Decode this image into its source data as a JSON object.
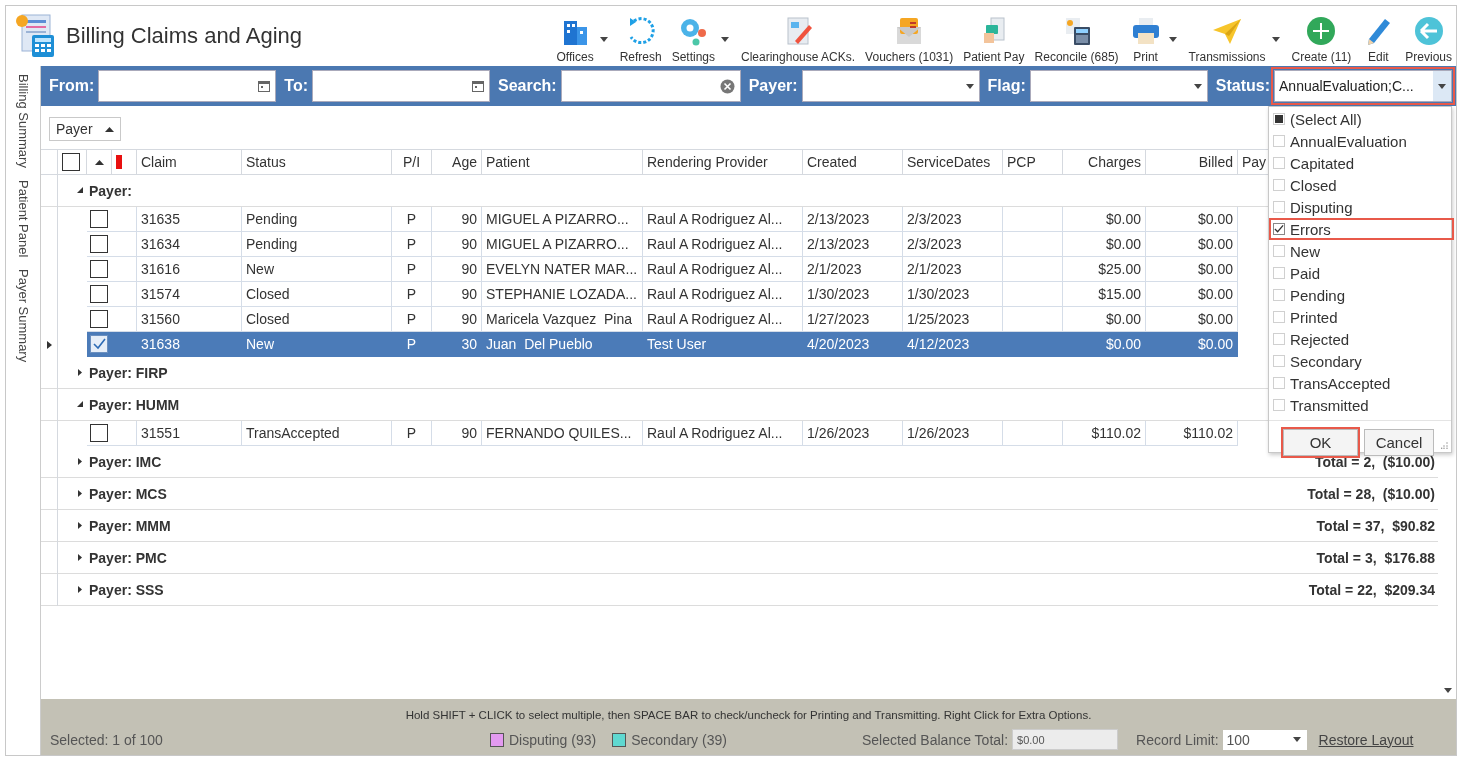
{
  "window": {
    "title": "Billing Claims and Aging"
  },
  "toolbar": [
    {
      "label": "Offices",
      "has_dropdown": true
    },
    {
      "label": "Refresh",
      "has_dropdown": false
    },
    {
      "label": "Settings",
      "has_dropdown": true
    },
    {
      "label": "Clearinghouse ACKs.",
      "has_dropdown": false
    },
    {
      "label": "Vouchers (1031)",
      "has_dropdown": false
    },
    {
      "label": "Patient Pay",
      "has_dropdown": false
    },
    {
      "label": "Reconcile (685)",
      "has_dropdown": false
    },
    {
      "label": "Print",
      "has_dropdown": true
    },
    {
      "label": "Transmissions",
      "has_dropdown": true
    },
    {
      "label": "Create (11)",
      "has_dropdown": false
    },
    {
      "label": "Edit",
      "has_dropdown": false
    },
    {
      "label": "Previous",
      "has_dropdown": false
    }
  ],
  "side_tabs": [
    "Billing Summary",
    "Patient Panel",
    "Payer Summary"
  ],
  "filters": [
    {
      "label": "From:",
      "kind": "date"
    },
    {
      "label": "To:",
      "kind": "date"
    },
    {
      "label": "Search:",
      "kind": "search"
    },
    {
      "label": "Payer:",
      "kind": "combo"
    },
    {
      "label": "Flag:",
      "kind": "combo"
    },
    {
      "label": "Status:",
      "kind": "combo",
      "value": "AnnualEvaluation;C...",
      "highlighted": true
    }
  ],
  "group_by": "Payer",
  "grid": {
    "header_checkbox": {
      "checked": false
    },
    "columns": [
      "Claim",
      "Status",
      "P/I",
      "Age",
      "Patient",
      "Rendering Provider",
      "Created",
      "ServiceDates",
      "PCP",
      "Charges",
      "Billed",
      "Pay"
    ],
    "groups": [
      {
        "label": "Payer:",
        "expanded": true,
        "rows": [
          {
            "checked": false,
            "selected": false,
            "cells": [
              "31635",
              "Pending",
              "P",
              "90",
              "MIGUEL A PIZARRO...",
              "Raul A Rodriguez Al...",
              "2/13/2023",
              "2/3/2023",
              null,
              "$0.00",
              "$0.00"
            ]
          },
          {
            "checked": false,
            "selected": false,
            "cells": [
              "31634",
              "Pending",
              "P",
              "90",
              "MIGUEL A PIZARRO...",
              "Raul A Rodriguez Al...",
              "2/13/2023",
              "2/3/2023",
              null,
              "$0.00",
              "$0.00"
            ]
          },
          {
            "checked": false,
            "selected": false,
            "cells": [
              "31616",
              "New",
              "P",
              "90",
              "EVELYN NATER MAR...",
              "Raul A Rodriguez Al...",
              "2/1/2023",
              "2/1/2023",
              null,
              "$25.00",
              "$0.00"
            ]
          },
          {
            "checked": false,
            "selected": false,
            "cells": [
              "31574",
              "Closed",
              "P",
              "90",
              "STEPHANIE LOZADA...",
              "Raul A Rodriguez Al...",
              "1/30/2023",
              "1/30/2023",
              null,
              "$15.00",
              "$0.00"
            ]
          },
          {
            "checked": false,
            "selected": false,
            "cells": [
              "31560",
              "Closed",
              "P",
              "90",
              "Maricela Vazquez  Pina",
              "Raul A Rodriguez Al...",
              "1/27/2023",
              "1/25/2023",
              null,
              "$0.00",
              "$0.00"
            ]
          },
          {
            "checked": true,
            "selected": true,
            "cells": [
              "31638",
              "New",
              "P",
              "30",
              "Juan  Del Pueblo",
              "Test User",
              "4/20/2023",
              "4/12/2023",
              null,
              "$0.00",
              "$0.00"
            ]
          }
        ]
      },
      {
        "label": "Payer: FIRP",
        "expanded": false
      },
      {
        "label": "Payer: HUMM",
        "expanded": true,
        "rows": [
          {
            "checked": false,
            "selected": false,
            "cells": [
              "31551",
              "TransAccepted",
              "P",
              "90",
              "FERNANDO QUILES...",
              "Raul A Rodriguez Al...",
              "1/26/2023",
              "1/26/2023",
              null,
              "$110.02",
              "$110.02"
            ]
          }
        ]
      },
      {
        "label": "Payer: IMC",
        "expanded": false,
        "total": "Total = 2,  ($10.00)"
      },
      {
        "label": "Payer: MCS",
        "expanded": false,
        "total": "Total = 28,  ($10.00)"
      },
      {
        "label": "Payer: MMM",
        "expanded": false,
        "total": "Total = 37,  $90.82"
      },
      {
        "label": "Payer: PMC",
        "expanded": false,
        "total": "Total = 3,  $176.88"
      },
      {
        "label": "Payer: SSS",
        "expanded": false,
        "total": "Total = 22,  $209.34"
      }
    ]
  },
  "status_dropdown": {
    "items": [
      {
        "label": "(Select All)",
        "checked": false,
        "partial": true,
        "highlighted": false
      },
      {
        "label": "AnnualEvaluation",
        "checked": false,
        "partial": false,
        "highlighted": false
      },
      {
        "label": "Capitated",
        "checked": false,
        "partial": false,
        "highlighted": false
      },
      {
        "label": "Closed",
        "checked": false,
        "partial": false,
        "highlighted": false
      },
      {
        "label": "Disputing",
        "checked": false,
        "partial": false,
        "highlighted": false
      },
      {
        "label": "Errors",
        "checked": true,
        "partial": false,
        "highlighted": true
      },
      {
        "label": "New",
        "checked": false,
        "partial": false,
        "highlighted": false
      },
      {
        "label": "Paid",
        "checked": false,
        "partial": false,
        "highlighted": false
      },
      {
        "label": "Pending",
        "checked": false,
        "partial": false,
        "highlighted": false
      },
      {
        "label": "Printed",
        "checked": false,
        "partial": false,
        "highlighted": false
      },
      {
        "label": "Rejected",
        "checked": false,
        "partial": false,
        "highlighted": false
      },
      {
        "label": "Secondary",
        "checked": false,
        "partial": false,
        "highlighted": false
      },
      {
        "label": "TransAccepted",
        "checked": false,
        "partial": false,
        "highlighted": false
      },
      {
        "label": "Transmitted",
        "checked": false,
        "partial": false,
        "highlighted": false
      }
    ],
    "buttons": [
      {
        "label": "OK",
        "highlighted": true
      },
      {
        "label": "Cancel",
        "highlighted": false
      }
    ]
  },
  "footer": {
    "hint": "Hold SHIFT + CLICK to select multiple, then SPACE BAR to check/uncheck for Printing and Transmitting. Right Click for Extra Options.",
    "selected": "Selected: 1 of 100",
    "legend": [
      {
        "label": "Disputing (93)",
        "color": "#e39af0"
      },
      {
        "label": "Secondary (39)",
        "color": "#5fd8d0"
      }
    ],
    "balance_label": "Selected Balance Total:",
    "balance_value": "$0.00",
    "record_limit_label": "Record Limit:",
    "record_limit": "100",
    "restore_link": "Restore Layout"
  }
}
